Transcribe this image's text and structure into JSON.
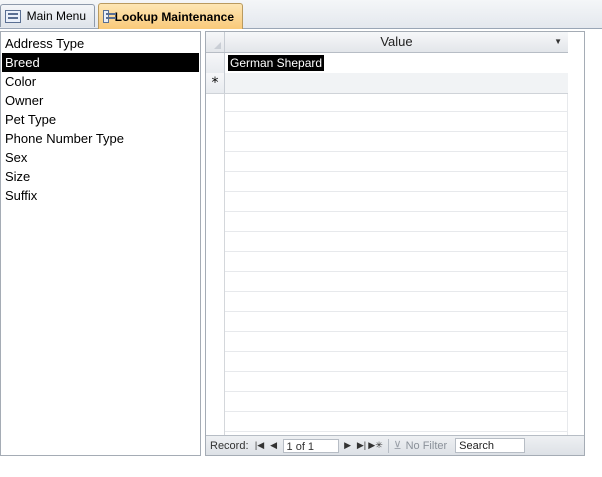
{
  "tabs": [
    {
      "label": "Main Menu",
      "icon": "form-icon"
    },
    {
      "label": "Lookup Maintenance",
      "icon": "form-icon",
      "active": true
    }
  ],
  "lookup_list": {
    "items": [
      "Address Type",
      "Breed",
      "Color",
      "Owner",
      "Pet Type",
      "Phone Number Type",
      "Sex",
      "Size",
      "Suffix"
    ],
    "selected": "Breed"
  },
  "datasheet": {
    "column_header": "Value",
    "rows": [
      {
        "value": "German Shepard"
      }
    ],
    "new_row_marker": "*"
  },
  "navigation": {
    "record_label": "Record:",
    "record_position": "1 of 1",
    "filter_label": "No Filter",
    "search_value": "Search"
  },
  "colors": {
    "active_tab": "#f9c979",
    "selection": "#000000"
  }
}
